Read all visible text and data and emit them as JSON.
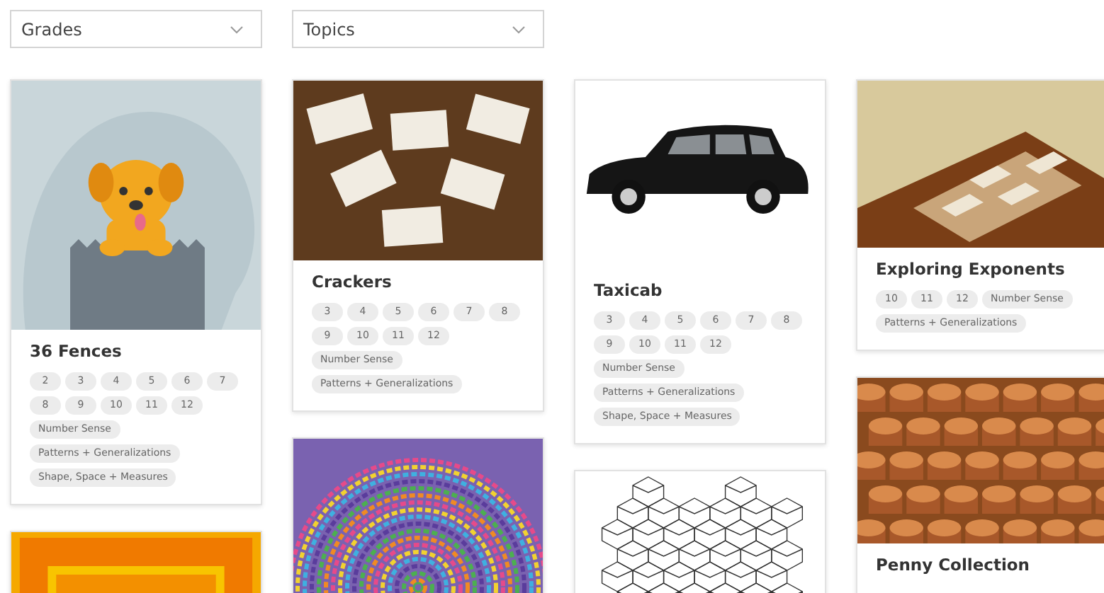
{
  "filters": [
    {
      "label": "Grades"
    },
    {
      "label": "Topics"
    }
  ],
  "columns": [
    {
      "cards": [
        {
          "kind": "dog",
          "title": "36 Fences",
          "grades": [
            "2",
            "3",
            "4",
            "5",
            "6",
            "7",
            "8",
            "9",
            "10",
            "11",
            "12"
          ],
          "topics": [
            "Number Sense",
            "Patterns + Generalizations",
            "Shape, Space + Measures"
          ]
        },
        {
          "kind": "gradient"
        }
      ]
    },
    {
      "cards": [
        {
          "kind": "cards",
          "title": "Crackers",
          "grades": [
            "3",
            "4",
            "5",
            "6",
            "7",
            "8",
            "9",
            "10",
            "11",
            "12"
          ],
          "topics": [
            "Number Sense",
            "Patterns + Generalizations"
          ]
        },
        {
          "kind": "spiral"
        }
      ]
    },
    {
      "cards": [
        {
          "kind": "car",
          "title": "Taxicab",
          "grades": [
            "3",
            "4",
            "5",
            "6",
            "7",
            "8",
            "9",
            "10",
            "11",
            "12"
          ],
          "topics": [
            "Number Sense",
            "Patterns + Generalizations",
            "Shape, Space + Measures"
          ]
        },
        {
          "kind": "hexagons"
        }
      ]
    },
    {
      "cards": [
        {
          "kind": "chessboard",
          "title": "Exploring Exponents",
          "grades": [
            "10",
            "11",
            "12"
          ],
          "topics": [
            "Number Sense",
            "Patterns + Generalizations"
          ]
        },
        {
          "kind": "coins",
          "title": "Penny Collection"
        }
      ]
    }
  ]
}
